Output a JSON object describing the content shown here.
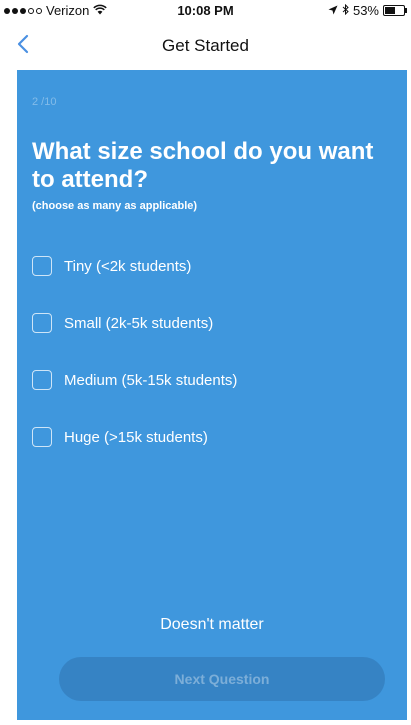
{
  "status_bar": {
    "carrier": "Verizon",
    "time": "10:08 PM",
    "battery": "53%",
    "battery_level": 0.53,
    "icons": [
      "signal-dots-icon",
      "wifi-icon",
      "location-icon",
      "bluetooth-icon",
      "battery-icon"
    ]
  },
  "nav": {
    "title": "Get Started",
    "back_icon": "chevron-left-icon"
  },
  "main": {
    "progress": "2 /10",
    "question": "What size school do you want to attend?",
    "hint": "(choose as many as applicable)",
    "options": [
      {
        "label": "Tiny (<2k students)",
        "checked": false
      },
      {
        "label": "Small (2k-5k students)",
        "checked": false
      },
      {
        "label": "Medium (5k-15k students)",
        "checked": false
      },
      {
        "label": "Huge (>15k students)",
        "checked": false
      }
    ],
    "doesnt_matter": "Doesn't matter",
    "next_button": "Next Question"
  },
  "colors": {
    "accent_blue": "#3f97dd",
    "button_blue": "#3683c4",
    "back_arrow": "#4a90e2"
  }
}
